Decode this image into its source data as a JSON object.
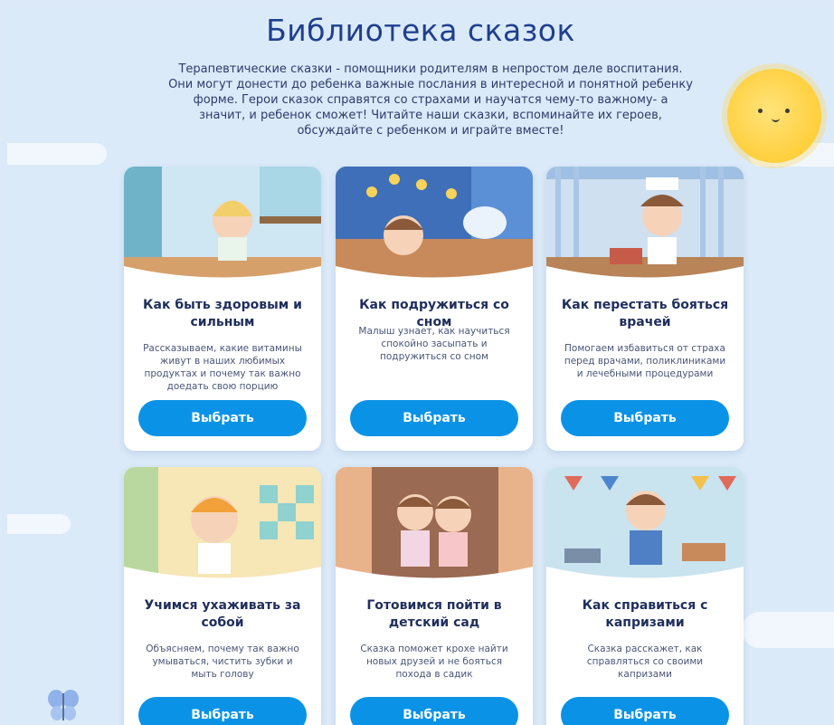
{
  "header": {
    "title": "Библиотека сказок",
    "intro": "Терапевтические сказки - помощники родителям в непростом деле воспитания. Они могут донести до ребенка важные послания в интересной и понятной ребенку форме. Герои сказок справятся со страхами и научатся чему-то важному- а значит, и ребенок сможет! Читайте наши сказки, вспоминайте их героев, обсуждайте с ребенком и играйте вместе!"
  },
  "cards": [
    {
      "title": "Как быть здоровым и сильным",
      "description": "Рассказываем, какие витамины живут в наших любимых продуктах и почему так важно доедать свою порцию",
      "button": "Выбрать"
    },
    {
      "title": "Как подружиться со сном",
      "description": "Малыш узнает, как научиться спокойно засыпать и подружиться со сном",
      "button": "Выбрать"
    },
    {
      "title": "Как перестать бояться врачей",
      "description": "Помогаем избавиться от страха перед врачами, поликлиниками и лечебными процедурами",
      "button": "Выбрать"
    },
    {
      "title": "Учимся ухаживать за собой",
      "description": "Объясняем, почему так важно умываться, чистить зубки и мыть голову",
      "button": "Выбрать"
    },
    {
      "title": "Готовимся пойти в детский сад",
      "description": "Сказка поможет крохе найти новых друзей и не бояться похода в садик",
      "button": "Выбрать"
    },
    {
      "title": "Как справиться с капризами",
      "description": "Сказка расскажет, как справляться со своими капризами",
      "button": "Выбрать"
    }
  ],
  "icons": {
    "sun": "sun-icon",
    "butterfly": "butterfly-icon"
  },
  "colors": {
    "accent": "#0a93e6",
    "title": "#1e3f8f",
    "background": "#dbeaf8"
  }
}
